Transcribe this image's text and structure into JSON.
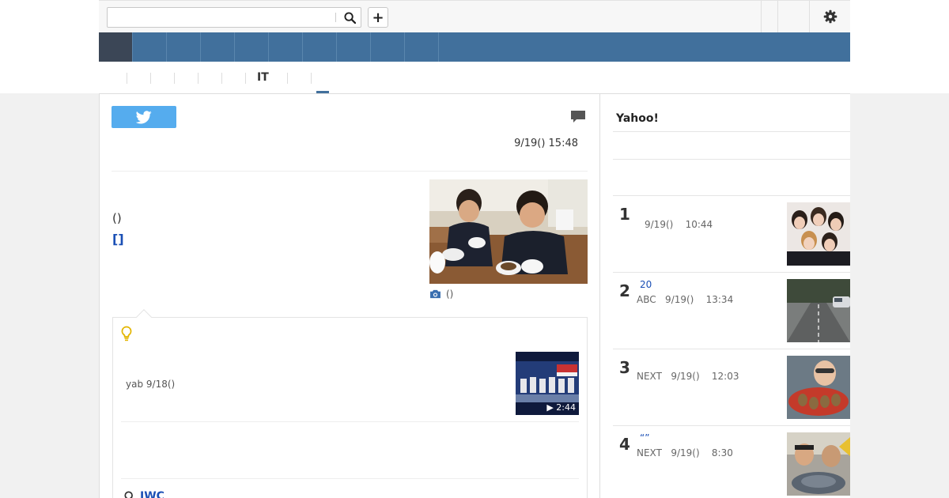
{
  "search": {
    "placeholder": "",
    "value": ""
  },
  "header": {
    "add_label": "+"
  },
  "colors": {
    "nav": "#41709c",
    "nav_active": "#3b4656",
    "twitter": "#55acee",
    "link": "#1a4fb5",
    "bulb": "#e3b500"
  },
  "subnav": {
    "category": "IT"
  },
  "article": {
    "datetime": "9/19() 15:48",
    "paren_text": "()",
    "link_text": "[]",
    "photo_caption": "()"
  },
  "video": {
    "meta": "yab 9/18()",
    "duration": "▶ 2:44"
  },
  "related": {
    "link": "JWC"
  },
  "sidebar": {
    "title": "Yahoo!",
    "rankings": [
      {
        "rank": "1",
        "title": "",
        "meta": "9/19()    10:44"
      },
      {
        "rank": "2",
        "title": "20",
        "meta": "ABC   9/19()    13:34"
      },
      {
        "rank": "3",
        "title": "",
        "meta": "NEXT   9/19()    12:03"
      },
      {
        "rank": "4",
        "title": "“”",
        "meta": "NEXT   9/19()    8:30"
      }
    ]
  },
  "icons": {
    "search": "search-icon",
    "add": "plus-icon",
    "gear": "gear-icon",
    "twitter": "twitter-bird-icon",
    "comment": "comment-icon",
    "camera": "camera-icon",
    "bulb": "lightbulb-icon",
    "search_link": "magnifier-icon"
  }
}
